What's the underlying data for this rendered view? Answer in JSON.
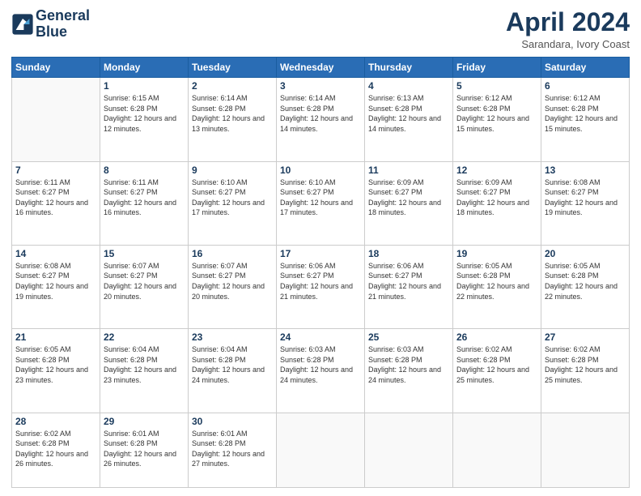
{
  "header": {
    "logo_line1": "General",
    "logo_line2": "Blue",
    "title": "April 2024",
    "subtitle": "Sarandara, Ivory Coast"
  },
  "weekdays": [
    "Sunday",
    "Monday",
    "Tuesday",
    "Wednesday",
    "Thursday",
    "Friday",
    "Saturday"
  ],
  "weeks": [
    [
      {
        "day": "",
        "sunrise": "",
        "sunset": "",
        "daylight": ""
      },
      {
        "day": "1",
        "sunrise": "Sunrise: 6:15 AM",
        "sunset": "Sunset: 6:28 PM",
        "daylight": "Daylight: 12 hours and 12 minutes."
      },
      {
        "day": "2",
        "sunrise": "Sunrise: 6:14 AM",
        "sunset": "Sunset: 6:28 PM",
        "daylight": "Daylight: 12 hours and 13 minutes."
      },
      {
        "day": "3",
        "sunrise": "Sunrise: 6:14 AM",
        "sunset": "Sunset: 6:28 PM",
        "daylight": "Daylight: 12 hours and 14 minutes."
      },
      {
        "day": "4",
        "sunrise": "Sunrise: 6:13 AM",
        "sunset": "Sunset: 6:28 PM",
        "daylight": "Daylight: 12 hours and 14 minutes."
      },
      {
        "day": "5",
        "sunrise": "Sunrise: 6:12 AM",
        "sunset": "Sunset: 6:28 PM",
        "daylight": "Daylight: 12 hours and 15 minutes."
      },
      {
        "day": "6",
        "sunrise": "Sunrise: 6:12 AM",
        "sunset": "Sunset: 6:28 PM",
        "daylight": "Daylight: 12 hours and 15 minutes."
      }
    ],
    [
      {
        "day": "7",
        "sunrise": "Sunrise: 6:11 AM",
        "sunset": "Sunset: 6:27 PM",
        "daylight": "Daylight: 12 hours and 16 minutes."
      },
      {
        "day": "8",
        "sunrise": "Sunrise: 6:11 AM",
        "sunset": "Sunset: 6:27 PM",
        "daylight": "Daylight: 12 hours and 16 minutes."
      },
      {
        "day": "9",
        "sunrise": "Sunrise: 6:10 AM",
        "sunset": "Sunset: 6:27 PM",
        "daylight": "Daylight: 12 hours and 17 minutes."
      },
      {
        "day": "10",
        "sunrise": "Sunrise: 6:10 AM",
        "sunset": "Sunset: 6:27 PM",
        "daylight": "Daylight: 12 hours and 17 minutes."
      },
      {
        "day": "11",
        "sunrise": "Sunrise: 6:09 AM",
        "sunset": "Sunset: 6:27 PM",
        "daylight": "Daylight: 12 hours and 18 minutes."
      },
      {
        "day": "12",
        "sunrise": "Sunrise: 6:09 AM",
        "sunset": "Sunset: 6:27 PM",
        "daylight": "Daylight: 12 hours and 18 minutes."
      },
      {
        "day": "13",
        "sunrise": "Sunrise: 6:08 AM",
        "sunset": "Sunset: 6:27 PM",
        "daylight": "Daylight: 12 hours and 19 minutes."
      }
    ],
    [
      {
        "day": "14",
        "sunrise": "Sunrise: 6:08 AM",
        "sunset": "Sunset: 6:27 PM",
        "daylight": "Daylight: 12 hours and 19 minutes."
      },
      {
        "day": "15",
        "sunrise": "Sunrise: 6:07 AM",
        "sunset": "Sunset: 6:27 PM",
        "daylight": "Daylight: 12 hours and 20 minutes."
      },
      {
        "day": "16",
        "sunrise": "Sunrise: 6:07 AM",
        "sunset": "Sunset: 6:27 PM",
        "daylight": "Daylight: 12 hours and 20 minutes."
      },
      {
        "day": "17",
        "sunrise": "Sunrise: 6:06 AM",
        "sunset": "Sunset: 6:27 PM",
        "daylight": "Daylight: 12 hours and 21 minutes."
      },
      {
        "day": "18",
        "sunrise": "Sunrise: 6:06 AM",
        "sunset": "Sunset: 6:27 PM",
        "daylight": "Daylight: 12 hours and 21 minutes."
      },
      {
        "day": "19",
        "sunrise": "Sunrise: 6:05 AM",
        "sunset": "Sunset: 6:28 PM",
        "daylight": "Daylight: 12 hours and 22 minutes."
      },
      {
        "day": "20",
        "sunrise": "Sunrise: 6:05 AM",
        "sunset": "Sunset: 6:28 PM",
        "daylight": "Daylight: 12 hours and 22 minutes."
      }
    ],
    [
      {
        "day": "21",
        "sunrise": "Sunrise: 6:05 AM",
        "sunset": "Sunset: 6:28 PM",
        "daylight": "Daylight: 12 hours and 23 minutes."
      },
      {
        "day": "22",
        "sunrise": "Sunrise: 6:04 AM",
        "sunset": "Sunset: 6:28 PM",
        "daylight": "Daylight: 12 hours and 23 minutes."
      },
      {
        "day": "23",
        "sunrise": "Sunrise: 6:04 AM",
        "sunset": "Sunset: 6:28 PM",
        "daylight": "Daylight: 12 hours and 24 minutes."
      },
      {
        "day": "24",
        "sunrise": "Sunrise: 6:03 AM",
        "sunset": "Sunset: 6:28 PM",
        "daylight": "Daylight: 12 hours and 24 minutes."
      },
      {
        "day": "25",
        "sunrise": "Sunrise: 6:03 AM",
        "sunset": "Sunset: 6:28 PM",
        "daylight": "Daylight: 12 hours and 24 minutes."
      },
      {
        "day": "26",
        "sunrise": "Sunrise: 6:02 AM",
        "sunset": "Sunset: 6:28 PM",
        "daylight": "Daylight: 12 hours and 25 minutes."
      },
      {
        "day": "27",
        "sunrise": "Sunrise: 6:02 AM",
        "sunset": "Sunset: 6:28 PM",
        "daylight": "Daylight: 12 hours and 25 minutes."
      }
    ],
    [
      {
        "day": "28",
        "sunrise": "Sunrise: 6:02 AM",
        "sunset": "Sunset: 6:28 PM",
        "daylight": "Daylight: 12 hours and 26 minutes."
      },
      {
        "day": "29",
        "sunrise": "Sunrise: 6:01 AM",
        "sunset": "Sunset: 6:28 PM",
        "daylight": "Daylight: 12 hours and 26 minutes."
      },
      {
        "day": "30",
        "sunrise": "Sunrise: 6:01 AM",
        "sunset": "Sunset: 6:28 PM",
        "daylight": "Daylight: 12 hours and 27 minutes."
      },
      {
        "day": "",
        "sunrise": "",
        "sunset": "",
        "daylight": ""
      },
      {
        "day": "",
        "sunrise": "",
        "sunset": "",
        "daylight": ""
      },
      {
        "day": "",
        "sunrise": "",
        "sunset": "",
        "daylight": ""
      },
      {
        "day": "",
        "sunrise": "",
        "sunset": "",
        "daylight": ""
      }
    ]
  ]
}
